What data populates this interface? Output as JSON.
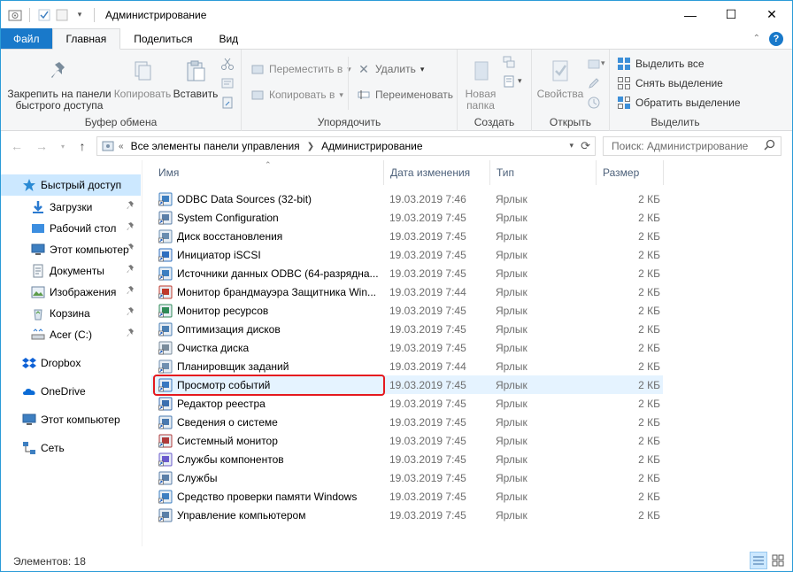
{
  "window": {
    "title": "Администрирование",
    "minimize": "—",
    "maximize": "☐",
    "close": "✕"
  },
  "tabs": [
    {
      "label": "Файл"
    },
    {
      "label": "Главная"
    },
    {
      "label": "Поделиться"
    },
    {
      "label": "Вид"
    }
  ],
  "ribbon": {
    "clipboard": {
      "label": "Буфер обмена",
      "pin": "Закрепить на панели быстрого доступа",
      "pin_line1": "Закрепить на панели",
      "pin_line2": "быстрого доступа",
      "copy": "Копировать",
      "paste": "Вставить"
    },
    "organize": {
      "label": "Упорядочить",
      "move_to": "Переместить в",
      "copy_to": "Копировать в",
      "delete": "Удалить",
      "rename": "Переименовать"
    },
    "create": {
      "label": "Создать",
      "new_folder_line1": "Новая",
      "new_folder_line2": "папка"
    },
    "open": {
      "label": "Открыть",
      "properties": "Свойства"
    },
    "select": {
      "label": "Выделить",
      "select_all": "Выделить все",
      "select_none": "Снять выделение",
      "invert": "Обратить выделение"
    }
  },
  "address": {
    "segments": [
      "Все элементы панели управления",
      "Администрирование"
    ],
    "prefix": "«"
  },
  "search": {
    "placeholder": "Поиск: Администрирование"
  },
  "nav": {
    "items": [
      {
        "label": "Быстрый доступ",
        "icon": "star-icon",
        "selected": true
      },
      {
        "label": "Загрузки",
        "icon": "download-icon",
        "pinned": true
      },
      {
        "label": "Рабочий стол",
        "icon": "desktop-folder-icon",
        "pinned": true
      },
      {
        "label": "Этот компьютер",
        "icon": "computer-icon",
        "pinned": true
      },
      {
        "label": "Документы",
        "icon": "documents-icon",
        "pinned": true
      },
      {
        "label": "Изображения",
        "icon": "pictures-icon",
        "pinned": true
      },
      {
        "label": "Корзина",
        "icon": "recycle-bin-icon",
        "pinned": true
      },
      {
        "label": "Acer (C:)",
        "icon": "drive-icon",
        "pinned": true
      },
      {
        "label": "Dropbox",
        "icon": "dropbox-icon"
      },
      {
        "label": "OneDrive",
        "icon": "onedrive-icon"
      },
      {
        "label": "Этот компьютер",
        "icon": "computer-icon"
      },
      {
        "label": "Сеть",
        "icon": "network-icon"
      }
    ]
  },
  "columns": {
    "name": "Имя",
    "date": "Дата изменения",
    "type": "Тип",
    "size": "Размер"
  },
  "files": [
    {
      "name": "ODBC Data Sources (32-bit)",
      "date": "19.03.2019 7:46",
      "type": "Ярлык",
      "size": "2 КБ"
    },
    {
      "name": "System Configuration",
      "date": "19.03.2019 7:45",
      "type": "Ярлык",
      "size": "2 КБ"
    },
    {
      "name": "Диск восстановления",
      "date": "19.03.2019 7:45",
      "type": "Ярлык",
      "size": "2 КБ"
    },
    {
      "name": "Инициатор iSCSI",
      "date": "19.03.2019 7:45",
      "type": "Ярлык",
      "size": "2 КБ"
    },
    {
      "name": "Источники данных ODBC (64-разрядна...",
      "date": "19.03.2019 7:45",
      "type": "Ярлык",
      "size": "2 КБ"
    },
    {
      "name": "Монитор брандмауэра Защитника Win...",
      "date": "19.03.2019 7:44",
      "type": "Ярлык",
      "size": "2 КБ"
    },
    {
      "name": "Монитор ресурсов",
      "date": "19.03.2019 7:45",
      "type": "Ярлык",
      "size": "2 КБ"
    },
    {
      "name": "Оптимизация дисков",
      "date": "19.03.2019 7:45",
      "type": "Ярлык",
      "size": "2 КБ"
    },
    {
      "name": "Очистка диска",
      "date": "19.03.2019 7:45",
      "type": "Ярлык",
      "size": "2 КБ"
    },
    {
      "name": "Планировщик заданий",
      "date": "19.03.2019 7:44",
      "type": "Ярлык",
      "size": "2 КБ"
    },
    {
      "name": "Просмотр событий",
      "date": "19.03.2019 7:45",
      "type": "Ярлык",
      "size": "2 КБ",
      "highlighted": true
    },
    {
      "name": "Редактор реестра",
      "date": "19.03.2019 7:45",
      "type": "Ярлык",
      "size": "2 КБ"
    },
    {
      "name": "Сведения о системе",
      "date": "19.03.2019 7:45",
      "type": "Ярлык",
      "size": "2 КБ"
    },
    {
      "name": "Системный монитор",
      "date": "19.03.2019 7:45",
      "type": "Ярлык",
      "size": "2 КБ"
    },
    {
      "name": "Службы компонентов",
      "date": "19.03.2019 7:45",
      "type": "Ярлык",
      "size": "2 КБ"
    },
    {
      "name": "Службы",
      "date": "19.03.2019 7:45",
      "type": "Ярлык",
      "size": "2 КБ"
    },
    {
      "name": "Средство проверки памяти Windows",
      "date": "19.03.2019 7:45",
      "type": "Ярлык",
      "size": "2 КБ"
    },
    {
      "name": "Управление компьютером",
      "date": "19.03.2019 7:45",
      "type": "Ярлык",
      "size": "2 КБ"
    }
  ],
  "status": {
    "items_count": "Элементов: 18"
  },
  "colors": {
    "accent": "#1979ca",
    "selection": "#cce8ff",
    "row_highlight": "#e5f3ff",
    "annotation_red": "#e5191f"
  }
}
